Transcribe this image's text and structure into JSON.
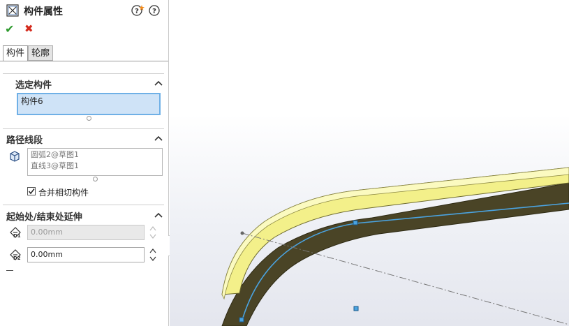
{
  "header": {
    "title": "构件属性"
  },
  "actions": {
    "ok_label": "✔",
    "cancel_label": "✖"
  },
  "tabs": [
    {
      "label": "构件"
    },
    {
      "label": "轮廓"
    }
  ],
  "selected_member": {
    "title": "选定构件",
    "value": "构件6"
  },
  "path_segments": {
    "title": "路径线段",
    "items": [
      "圆弧2@草图1",
      "直线3@草图1"
    ],
    "merge_label": "合并相切构件",
    "merge_checked": true
  },
  "extension": {
    "title": "起始处/结束处延伸",
    "d1_value": "0.00mm",
    "d2_value": "0.00mm",
    "d1_tag": "D1",
    "d2_tag": "D2"
  },
  "colors": {
    "accent_select": "#cfe3f7",
    "select_border": "#6fb0e6",
    "ok": "#2e9a2e",
    "cancel": "#d42a1c",
    "body_yellow": "#f3f08a",
    "body_dark": "#4a4426",
    "path_line": "#4aa3e0"
  }
}
